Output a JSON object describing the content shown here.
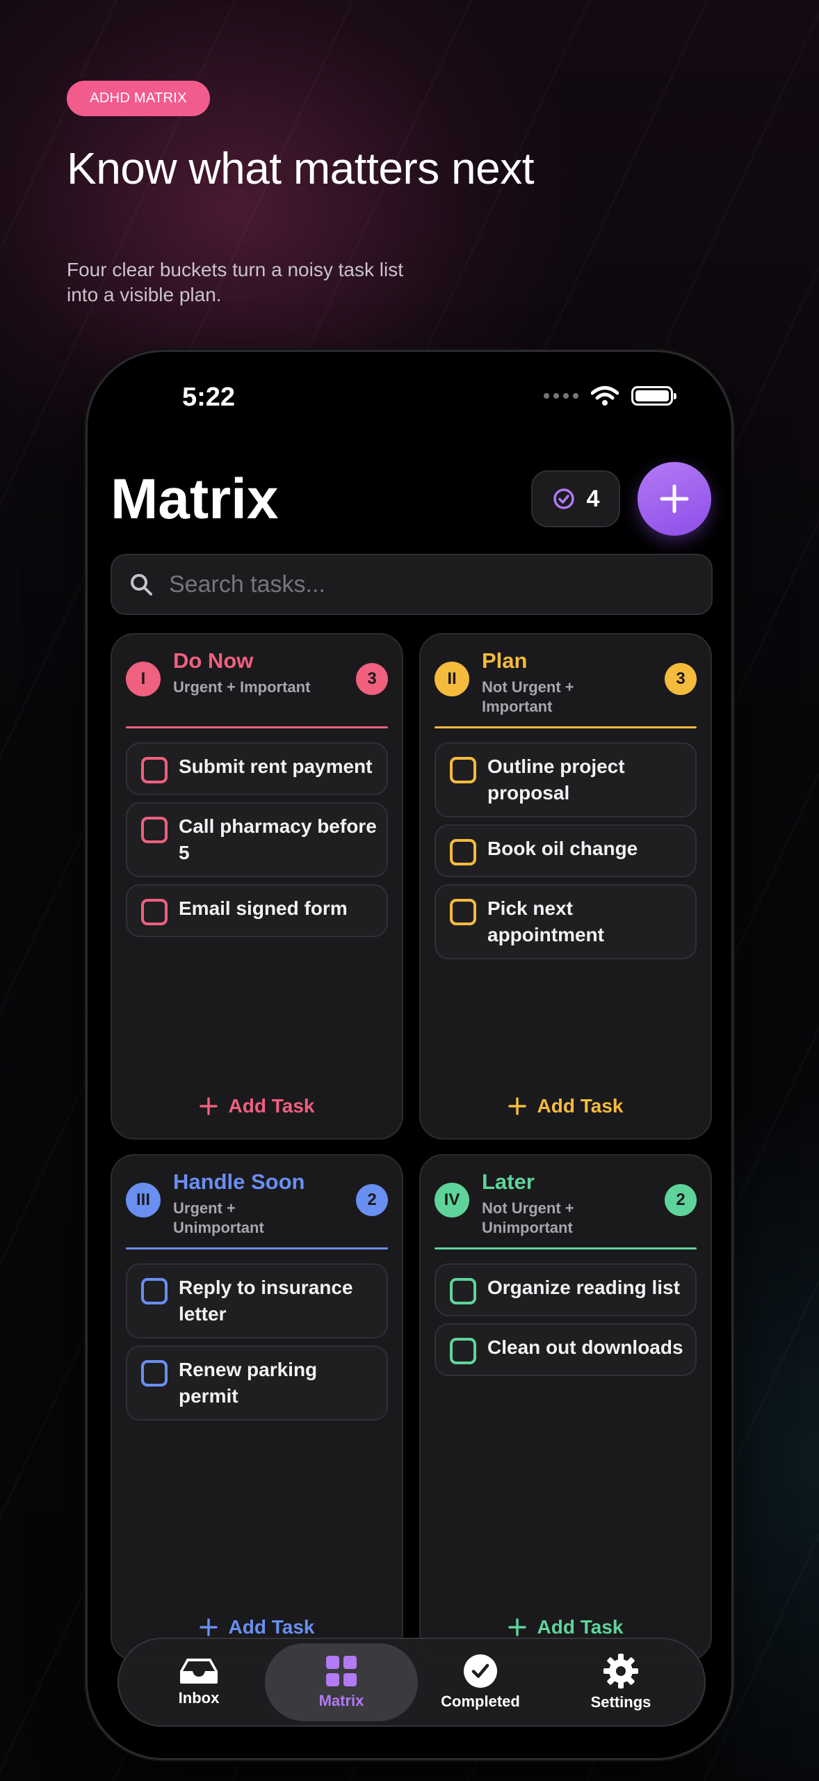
{
  "promo": {
    "tag": "ADHD MATRIX",
    "headline": "Know what matters next",
    "subline": "Four clear buckets turn a noisy task list into a visible plan."
  },
  "status_bar": {
    "time": "5:22"
  },
  "header": {
    "title": "Matrix",
    "completed_count": "4"
  },
  "search": {
    "placeholder": "Search tasks..."
  },
  "quadrants": [
    {
      "numeral": "I",
      "title": "Do Now",
      "subtitle": "Urgent + Important",
      "count": "3",
      "color": "#f0607f",
      "tasks": [
        "Submit rent payment",
        "Call pharmacy before 5",
        "Email signed form"
      ],
      "add_label": "Add Task"
    },
    {
      "numeral": "II",
      "title": "Plan",
      "subtitle": "Not Urgent + Important",
      "count": "3",
      "color": "#f5bb3c",
      "tasks": [
        "Outline project proposal",
        "Book oil change",
        "Pick next appointment"
      ],
      "add_label": "Add Task"
    },
    {
      "numeral": "III",
      "title": "Handle Soon",
      "subtitle": "Urgent + Unimportant",
      "count": "2",
      "color": "#6a8ff2",
      "tasks": [
        "Reply to insurance letter",
        "Renew parking permit"
      ],
      "add_label": "Add Task"
    },
    {
      "numeral": "IV",
      "title": "Later",
      "subtitle": "Not Urgent + Unimportant",
      "count": "2",
      "color": "#5fd49a",
      "tasks": [
        "Organize reading list",
        "Clean out downloads"
      ],
      "add_label": "Add Task"
    }
  ],
  "tab_bar": {
    "inbox": "Inbox",
    "matrix": "Matrix",
    "completed": "Completed",
    "settings": "Settings",
    "active": "Matrix",
    "accent": "#b27af5"
  }
}
